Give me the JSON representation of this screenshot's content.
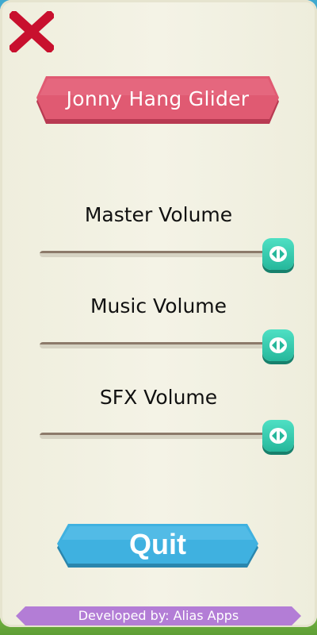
{
  "title": "Jonny Hang Glider",
  "close_icon": "close-icon",
  "sliders": [
    {
      "label": "Master Volume",
      "level": 1.0
    },
    {
      "label": "Music Volume",
      "level": 1.0
    },
    {
      "label": "SFX Volume",
      "level": 1.0
    }
  ],
  "quit_label": "Quit",
  "footer": "Developed by: Alias Apps",
  "colors": {
    "title_banner": "#e05a72",
    "quit_button": "#3fb1e0",
    "slider_knob": "#3fd4b6",
    "footer_banner": "#b37dd6",
    "close_icon": "#c8102e"
  }
}
